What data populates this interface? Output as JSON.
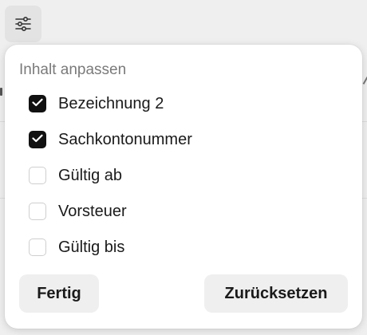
{
  "toolbar": {
    "settings_icon": "sliders-icon"
  },
  "popover": {
    "title": "Inhalt anpassen",
    "options": [
      {
        "label": "Bezeichnung 2",
        "checked": true
      },
      {
        "label": "Sachkontonummer",
        "checked": true
      },
      {
        "label": "Gültig ab",
        "checked": false
      },
      {
        "label": "Vorsteuer",
        "checked": false
      },
      {
        "label": "Gültig bis",
        "checked": false
      }
    ],
    "done_label": "Fertig",
    "reset_label": "Zurücksetzen"
  },
  "colors": {
    "checked_fill": "#111111",
    "unchecked_border": "#cfcfcf",
    "button_bg": "#efefef",
    "title_text": "#7a7a7a"
  }
}
